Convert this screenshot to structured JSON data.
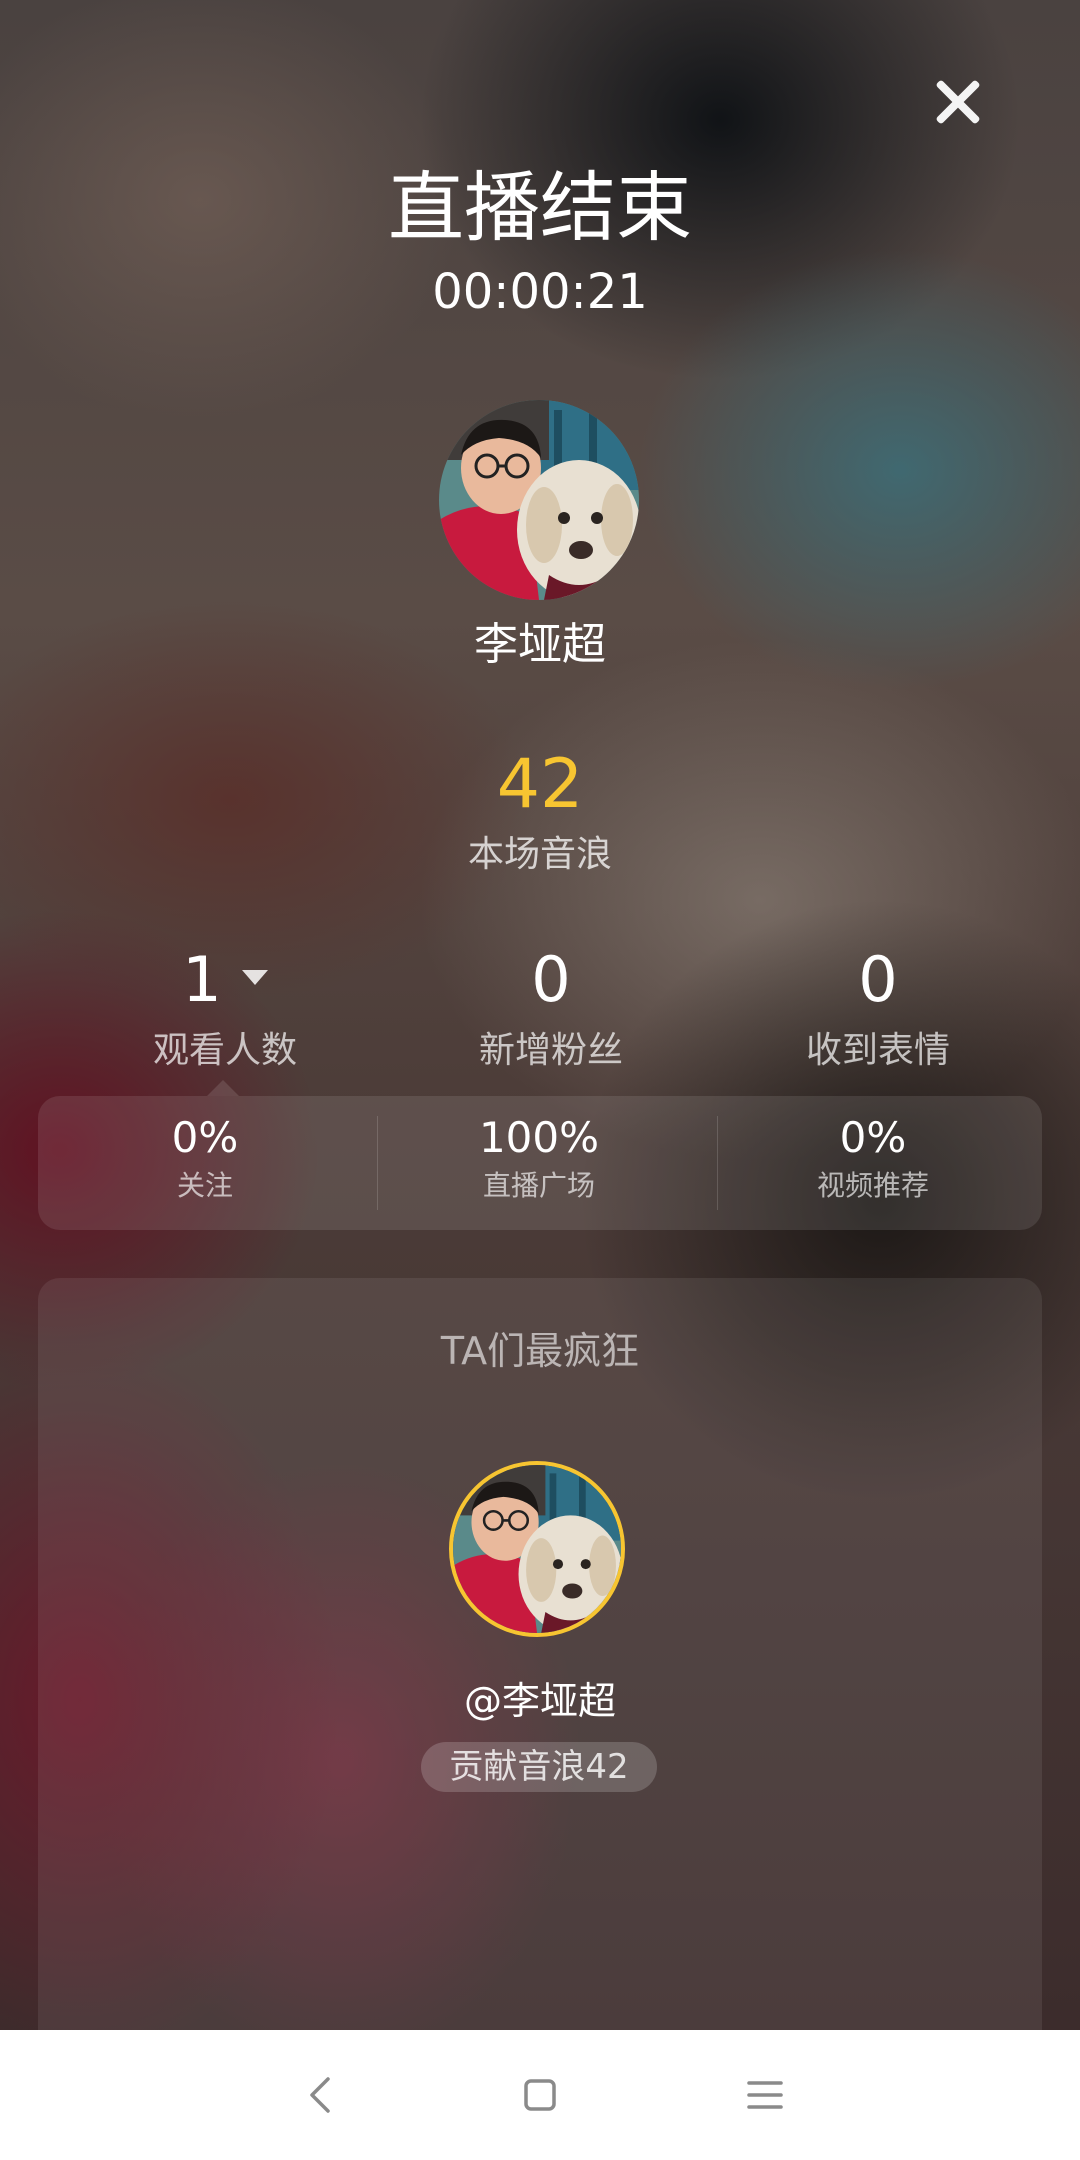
{
  "header": {
    "title": "直播结束",
    "duration": "00:00:21"
  },
  "host": {
    "name": "李垭超"
  },
  "score": {
    "value": "42",
    "label": "本场音浪"
  },
  "stats": [
    {
      "value": "1",
      "label": "观看人数"
    },
    {
      "value": "0",
      "label": "新增粉丝"
    },
    {
      "value": "0",
      "label": "收到表情"
    }
  ],
  "sources": [
    {
      "percent": "0%",
      "label": "关注"
    },
    {
      "percent": "100%",
      "label": "直播广场"
    },
    {
      "percent": "0%",
      "label": "视频推荐"
    }
  ],
  "top_fans": {
    "title": "TA们最疯狂",
    "fan_name": "@李垭超",
    "contribution": "贡献音浪42"
  },
  "colors": {
    "accent": "#f7c531"
  },
  "icons": {
    "close": "close-icon",
    "caret": "caret-down-icon",
    "nav_back": "back-icon",
    "nav_home": "home-icon",
    "nav_menu": "menu-icon"
  }
}
